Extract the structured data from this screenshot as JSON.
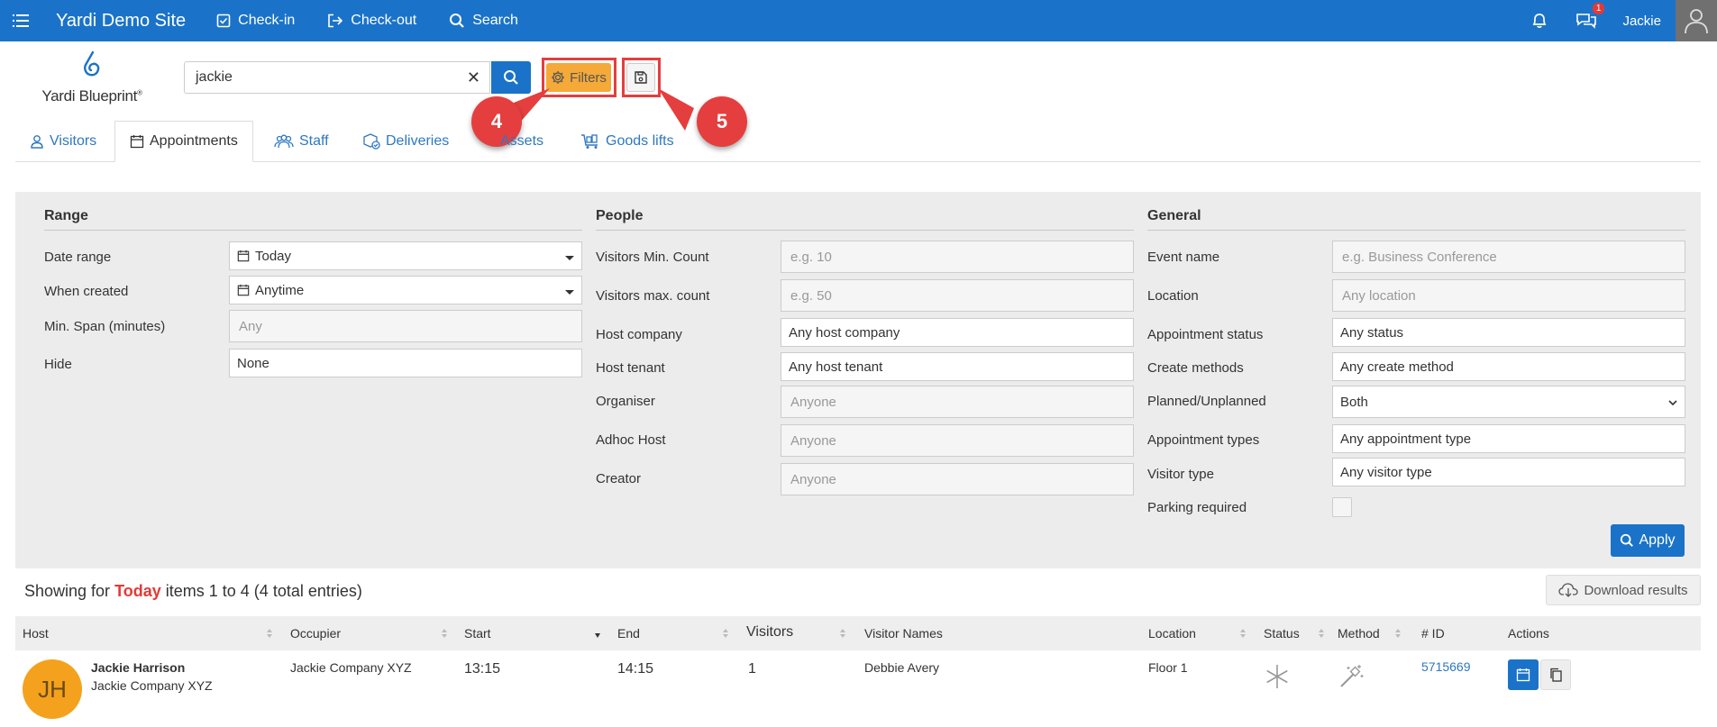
{
  "topbar": {
    "site_title": "Yardi Demo Site",
    "links": [
      "Check-in",
      "Check-out",
      "Search"
    ],
    "notification_count": "1",
    "user": "Jackie"
  },
  "logo": {
    "text": "Yardi Blueprint",
    "mark": "®"
  },
  "search": {
    "value": "jackie",
    "filters_label": "Filters"
  },
  "callouts": [
    "4",
    "5"
  ],
  "tabs": [
    "Visitors",
    "Appointments",
    "Staff",
    "Deliveries",
    "Assets",
    "Goods lifts"
  ],
  "active_tab": "Appointments",
  "filters": {
    "range": {
      "title": "Range",
      "date_range_label": "Date range",
      "date_range_value": "Today",
      "when_created_label": "When created",
      "when_created_value": "Anytime",
      "min_span_label": "Min. Span (minutes)",
      "min_span_placeholder": "Any",
      "hide_label": "Hide",
      "hide_value": "None"
    },
    "people": {
      "title": "People",
      "visitors_min_label": "Visitors Min. Count",
      "visitors_min_placeholder": "e.g. 10",
      "visitors_max_label": "Visitors max. count",
      "visitors_max_placeholder": "e.g. 50",
      "host_company_label": "Host company",
      "host_company_value": "Any host company",
      "host_tenant_label": "Host tenant",
      "host_tenant_value": "Any host tenant",
      "organiser_label": "Organiser",
      "organiser_placeholder": "Anyone",
      "adhoc_host_label": "Adhoc Host",
      "adhoc_host_placeholder": "Anyone",
      "creator_label": "Creator",
      "creator_placeholder": "Anyone"
    },
    "general": {
      "title": "General",
      "event_name_label": "Event name",
      "event_name_placeholder": "e.g. Business Conference",
      "location_label": "Location",
      "location_placeholder": "Any location",
      "status_label": "Appointment status",
      "status_value": "Any status",
      "create_methods_label": "Create methods",
      "create_methods_value": "Any create method",
      "planned_label": "Planned/Unplanned",
      "planned_value": "Both",
      "appt_types_label": "Appointment types",
      "appt_types_value": "Any appointment type",
      "visitor_type_label": "Visitor type",
      "visitor_type_value": "Any visitor type",
      "parking_label": "Parking required"
    },
    "apply_label": "Apply"
  },
  "results": {
    "showing_prefix": "Showing for",
    "showing_period": "Today",
    "showing_suffix": "items 1 to 4 (4 total entries)",
    "download_label": "Download results",
    "columns": [
      "Host",
      "Occupier",
      "Start",
      "End",
      "Visitors",
      "Visitor Names",
      "Location",
      "Status",
      "Method",
      "# ID",
      "Actions"
    ],
    "rows": [
      {
        "initials": "JH",
        "host_name": "Jackie Harrison",
        "host_company": "Jackie Company XYZ",
        "occupier": "Jackie Company XYZ",
        "start": "13:15",
        "end": "14:15",
        "visitors": "1",
        "visitor_names": "Debbie Avery",
        "location": "Floor 1",
        "id": "5715669"
      }
    ]
  },
  "colors": {
    "primary": "#1a73c9",
    "accent": "#f4a938",
    "highlight": "#e53e3e"
  }
}
